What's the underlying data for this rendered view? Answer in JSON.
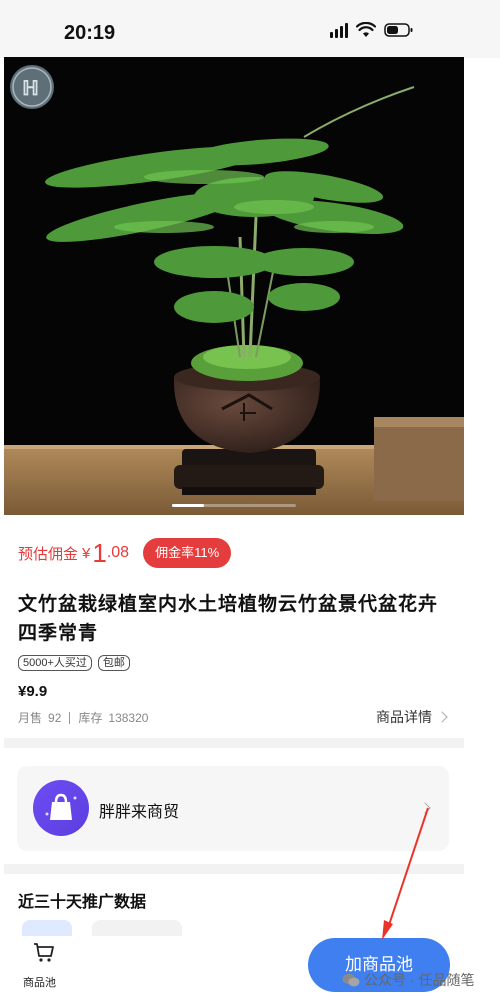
{
  "status_bar": {
    "time": "20:19"
  },
  "product": {
    "commission": {
      "label": "预估佣金",
      "currency": "¥",
      "amount_int": "1",
      "amount_dec": ".08",
      "rate": "佣金率11%"
    },
    "title": "文竹盆栽绿植室内水土培植物云竹盆景代盆花卉四季常青",
    "tags": [
      "5000+人买过",
      "包邮"
    ],
    "price": "¥9.9",
    "sales_label": "月售",
    "sales_value": "92",
    "stock_label": "库存",
    "stock_value": "138320",
    "detail_link": "商品详情"
  },
  "shop": {
    "name": "胖胖来商贸"
  },
  "section": {
    "title": "近三十天推广数据"
  },
  "bottom_bar": {
    "pool_label": "商品池",
    "add_button": "加商品池"
  },
  "watermark": {
    "text": "公众号 · 任品随笔"
  },
  "colors": {
    "accent_red": "#e53d3d",
    "primary_blue": "#3f7ff0",
    "annotation_arrow": "#e8352c"
  },
  "icons": [
    "cart-icon",
    "shop-bag-icon",
    "wechat-icon",
    "chevron-right-icon"
  ]
}
